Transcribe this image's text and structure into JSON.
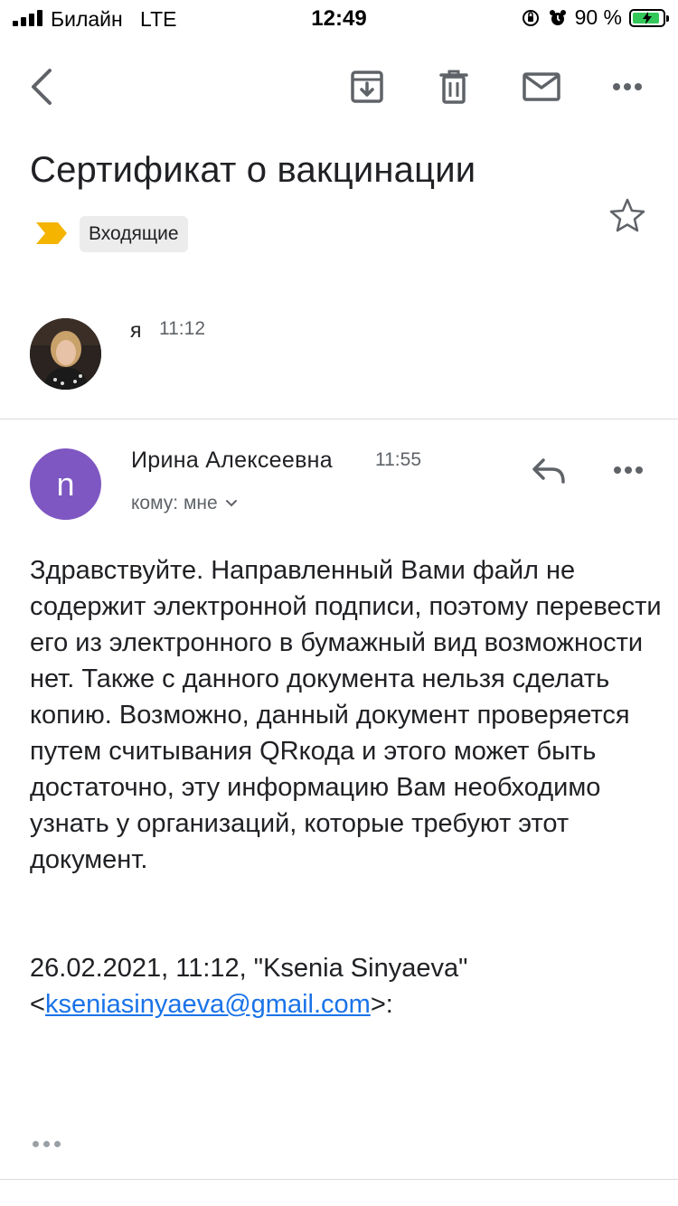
{
  "status_bar": {
    "carrier": "Билайн",
    "network": "LTE",
    "time": "12:49",
    "battery_percent": "90 %",
    "battery_level": 0.9
  },
  "toolbar": {
    "back_icon": "back-arrow-icon",
    "archive_icon": "archive-icon",
    "delete_icon": "trash-icon",
    "mark_unread_icon": "mail-icon",
    "more_icon": "more-horizontal-icon"
  },
  "email": {
    "subject": "Сертификат о вакцинации",
    "label": "Входящие",
    "label_color": "#f4b400"
  },
  "collapsed_message": {
    "sender": "я",
    "time": "11:12"
  },
  "message": {
    "avatar_letter": "n",
    "avatar_color": "#7e57c2",
    "sender": "Ирина Алексеевна",
    "time": "11:55",
    "to": "кому: мне",
    "body": "Здравствуйте. Направленный Вами файл не содержит электронной подписи, поэтому перевести его из электронного в бумажный вид возможности нет. Также с данного документа нельзя сделать копию. Возможно, данный документ проверяется путем считывания QRкода и этого может быть достаточно, эту информацию Вам необходимо узнать у организаций, которые требуют этот документ.",
    "quote_header": "26.02.2021, 11:12, \"Ksenia Sinyaeva\"",
    "quote_lt": "<",
    "quote_email": "kseniasinyaeva@gmail.com",
    "quote_gt": ">:"
  }
}
